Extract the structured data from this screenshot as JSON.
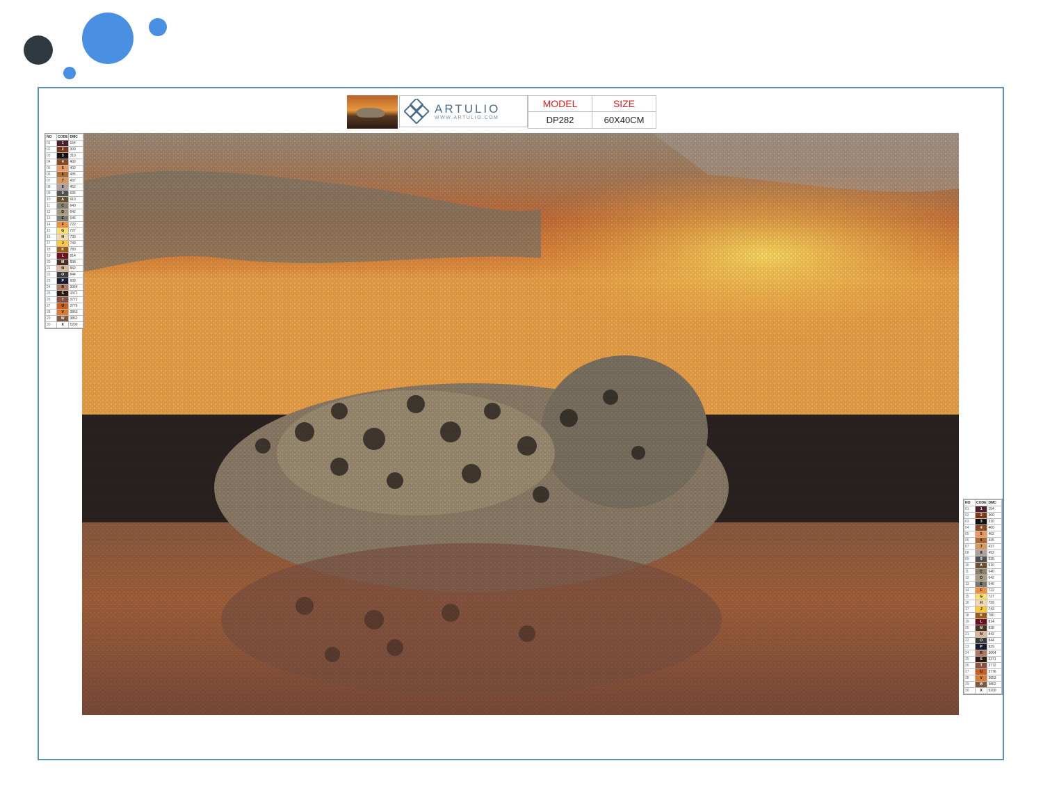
{
  "brand": {
    "name": "ARTULIO",
    "url": "WWW.ARTULIO.COM"
  },
  "spec": {
    "model_label": "MODEL",
    "size_label": "SIZE",
    "model_value": "DP282",
    "size_value": "60X40CM"
  },
  "colors": {
    "accent": "#4a90e2",
    "dark": "#2f3a40",
    "frame": "#5d8fb0",
    "header_red": "#d41f1f"
  },
  "legend": {
    "headers": [
      "NO",
      "CODE",
      "DMC"
    ],
    "rows": [
      {
        "no": "01",
        "code": "1",
        "dmc": "154",
        "color": "#4a2030"
      },
      {
        "no": "02",
        "code": "2",
        "dmc": "300",
        "color": "#7a3a18"
      },
      {
        "no": "03",
        "code": "3",
        "dmc": "310",
        "color": "#111111"
      },
      {
        "no": "04",
        "code": "4",
        "dmc": "400",
        "color": "#8a4a20"
      },
      {
        "no": "05",
        "code": "5",
        "dmc": "402",
        "color": "#e89a60"
      },
      {
        "no": "06",
        "code": "6",
        "dmc": "435",
        "color": "#b06a30"
      },
      {
        "no": "07",
        "code": "7",
        "dmc": "437",
        "color": "#d09a60"
      },
      {
        "no": "08",
        "code": "8",
        "dmc": "452",
        "color": "#b0a0a0"
      },
      {
        "no": "09",
        "code": "9",
        "dmc": "535",
        "color": "#505050"
      },
      {
        "no": "10",
        "code": "A",
        "dmc": "610",
        "color": "#6a5030"
      },
      {
        "no": "11",
        "code": "C",
        "dmc": "640",
        "color": "#8a8070"
      },
      {
        "no": "12",
        "code": "D",
        "dmc": "642",
        "color": "#a89a80"
      },
      {
        "no": "13",
        "code": "E",
        "dmc": "646",
        "color": "#7a7a70"
      },
      {
        "no": "14",
        "code": "F",
        "dmc": "722",
        "color": "#f0903a"
      },
      {
        "no": "15",
        "code": "G",
        "dmc": "727",
        "color": "#f8e070"
      },
      {
        "no": "16",
        "code": "H",
        "dmc": "739",
        "color": "#f0d8b0"
      },
      {
        "no": "17",
        "code": "J",
        "dmc": "743",
        "color": "#f8c840"
      },
      {
        "no": "18",
        "code": "K",
        "dmc": "780",
        "color": "#9a5a18"
      },
      {
        "no": "19",
        "code": "L",
        "dmc": "814",
        "color": "#6a1020"
      },
      {
        "no": "20",
        "code": "M",
        "dmc": "838",
        "color": "#4a3020"
      },
      {
        "no": "21",
        "code": "N",
        "dmc": "842",
        "color": "#d8b898"
      },
      {
        "no": "22",
        "code": "O",
        "dmc": "844",
        "color": "#3a3a3a"
      },
      {
        "no": "23",
        "code": "P",
        "dmc": "939",
        "color": "#1a1a30"
      },
      {
        "no": "24",
        "code": "R",
        "dmc": "3064",
        "color": "#b07a60"
      },
      {
        "no": "25",
        "code": "S",
        "dmc": "3371",
        "color": "#2a1a10"
      },
      {
        "no": "26",
        "code": "T",
        "dmc": "3772",
        "color": "#8a5040"
      },
      {
        "no": "27",
        "code": "U",
        "dmc": "3776",
        "color": "#c86020"
      },
      {
        "no": "28",
        "code": "V",
        "dmc": "3853",
        "color": "#e07a30"
      },
      {
        "no": "29",
        "code": "W",
        "dmc": "3862",
        "color": "#7a5a40"
      },
      {
        "no": "30",
        "code": "X",
        "dmc": "5200",
        "color": "#ffffff"
      }
    ]
  }
}
